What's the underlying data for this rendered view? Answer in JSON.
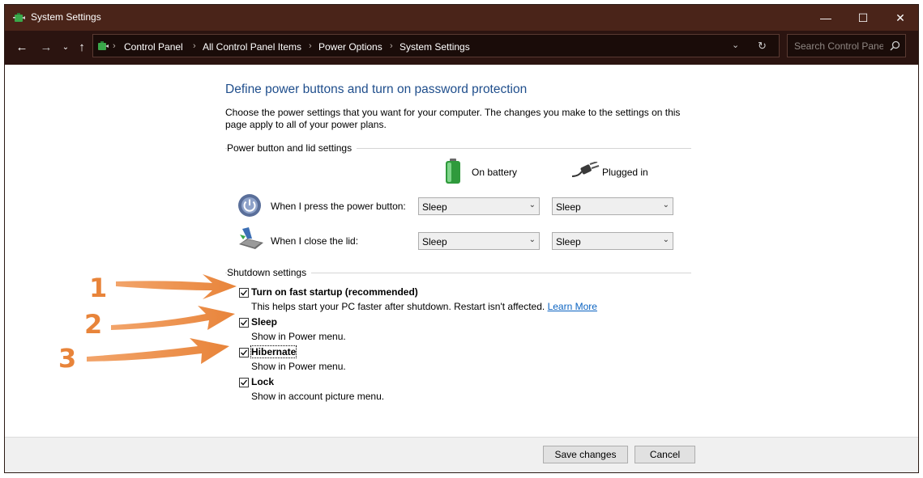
{
  "window": {
    "title": "System Settings"
  },
  "nav": {
    "breadcrumbs": [
      "Control Panel",
      "All Control Panel Items",
      "Power Options",
      "System Settings"
    ],
    "search_placeholder": "Search Control Panel"
  },
  "main": {
    "heading": "Define power buttons and turn on password protection",
    "description": "Choose the power settings that you want for your computer. The changes you make to the settings on this page apply to all of your power plans.",
    "power_group": {
      "label": "Power button and lid settings",
      "columns": [
        "On battery",
        "Plugged in"
      ],
      "rows": [
        {
          "label": "When I press the power button:",
          "battery": "Sleep",
          "plugged": "Sleep",
          "icon": "power-button-icon"
        },
        {
          "label": "When I close the lid:",
          "battery": "Sleep",
          "plugged": "Sleep",
          "icon": "laptop-lid-icon"
        }
      ]
    },
    "shutdown_group": {
      "label": "Shutdown settings",
      "options": [
        {
          "label": "Turn on fast startup (recommended)",
          "desc": "This helps start your PC faster after shutdown. Restart isn't affected.",
          "link": "Learn More",
          "checked": true
        },
        {
          "label": "Sleep",
          "desc": "Show in Power menu.",
          "checked": true
        },
        {
          "label": "Hibernate",
          "desc": "Show in Power menu.",
          "checked": true
        },
        {
          "label": "Lock",
          "desc": "Show in account picture menu.",
          "checked": true
        }
      ]
    }
  },
  "footer": {
    "save_label": "Save changes",
    "cancel_label": "Cancel"
  },
  "annotations": {
    "callouts": [
      "1",
      "2",
      "3"
    ],
    "color": "#e8843a"
  },
  "colors": {
    "titlebar": "#4a2419",
    "heading": "#1f4e8c",
    "link": "#0b63c1"
  }
}
